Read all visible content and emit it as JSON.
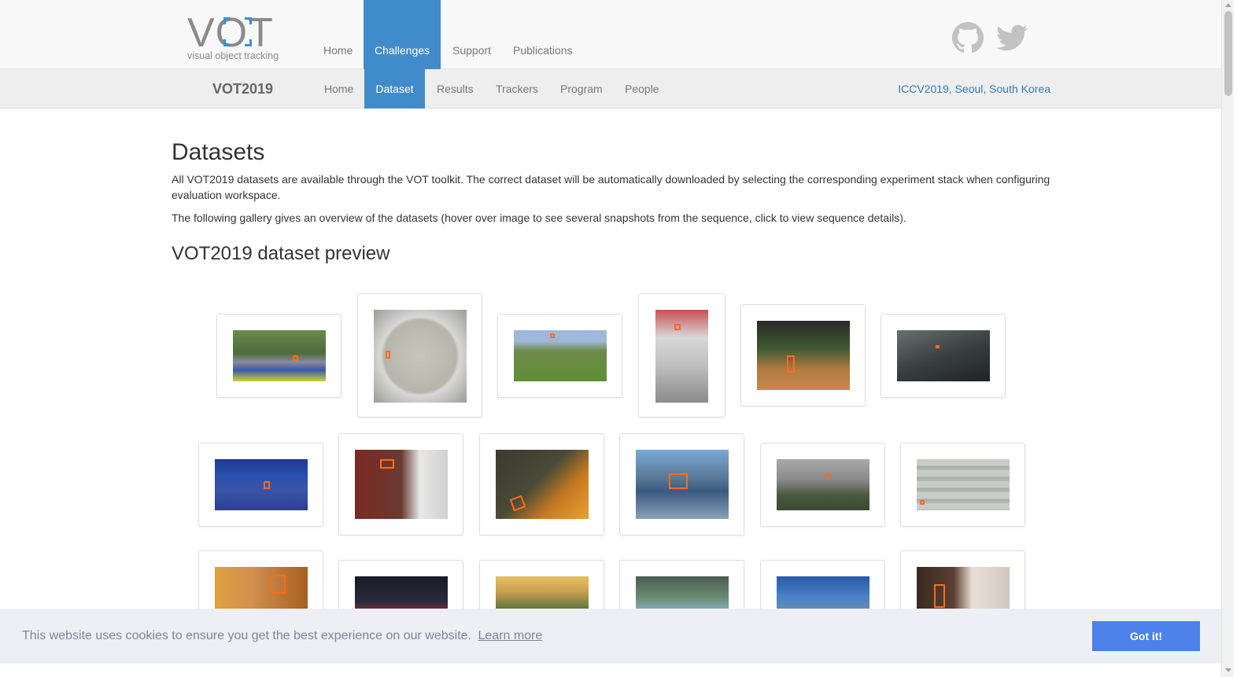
{
  "brand": {
    "logo_text": "VOT",
    "logo_subtitle": "visual object tracking"
  },
  "top_nav": [
    "Home",
    "Challenges",
    "Support",
    "Publications"
  ],
  "top_nav_active": "Challenges",
  "social_icons": [
    "github-icon",
    "twitter-icon"
  ],
  "sub_nav": {
    "title": "VOT2019",
    "items": [
      "Home",
      "Dataset",
      "Results",
      "Trackers",
      "Program",
      "People"
    ],
    "active": "Dataset",
    "event": "ICCV2019, Seoul, South Korea"
  },
  "content": {
    "heading": "Datasets",
    "paragraph1": "All VOT2019 datasets are available through the VOT toolkit. The correct dataset will be automatically downloaded by selecting the corresponding experiment stack when configuring evaluation workspace.",
    "paragraph2": "The following gallery gives an overview of the datasets (hover over image to see several snapshots from the sequence, click to view sequence details).",
    "subheading": "VOT2019 dataset preview"
  },
  "gallery_count": 18,
  "cookie_banner": {
    "message": "This website uses cookies to ensure you get the best experience on our website.",
    "learn_more": "Learn more",
    "accept": "Got it!"
  },
  "colors": {
    "accent": "#428bca",
    "link": "#337ab7",
    "box": "#ff6a1f",
    "cookie_button": "#4b81e8"
  }
}
